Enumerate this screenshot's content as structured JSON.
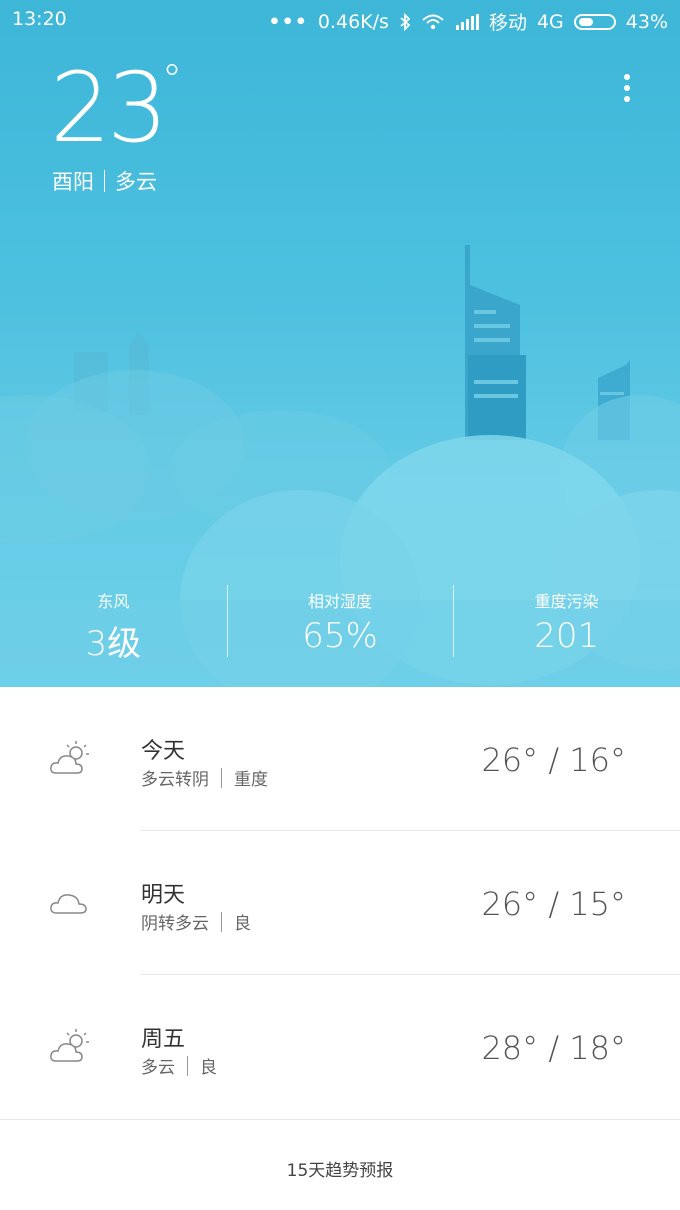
{
  "status_bar": {
    "time": "13:20",
    "network_speed": "0.46K/s",
    "carrier": "移动",
    "network_type": "4G",
    "battery": "43%",
    "icons": [
      "more-dots-icon",
      "bluetooth-icon",
      "wifi-icon",
      "signal-icon",
      "battery-icon"
    ]
  },
  "current": {
    "temperature": "23",
    "degree": "°",
    "city": "酉阳",
    "condition": "多云"
  },
  "stats": [
    {
      "label": "东风",
      "value": "3级"
    },
    {
      "label": "相对湿度",
      "value": "65%"
    },
    {
      "label": "重度污染",
      "value": "201"
    }
  ],
  "forecast": [
    {
      "day": "今天",
      "condition": "多云转阴",
      "air": "重度",
      "range": "26° / 16°",
      "icon": "partly-cloudy-icon"
    },
    {
      "day": "明天",
      "condition": "阴转多云",
      "air": "良",
      "range": "26° / 15°",
      "icon": "cloud-icon"
    },
    {
      "day": "周五",
      "condition": "多云",
      "air": "良",
      "range": "28° / 18°",
      "icon": "partly-cloudy-icon"
    }
  ],
  "footer": {
    "link": "15天趋势预报"
  },
  "colors": {
    "sky_top": "#3db6d8",
    "sky_bottom": "#6ccfe8",
    "text_dark": "#333333"
  }
}
